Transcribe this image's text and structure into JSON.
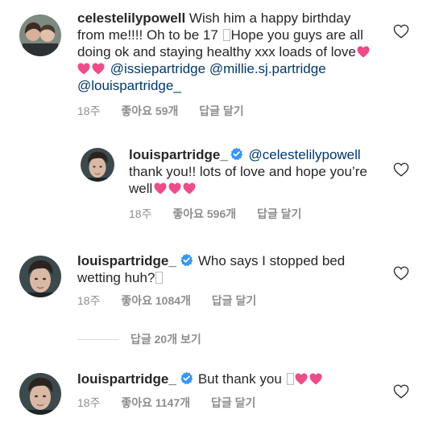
{
  "comments": [
    {
      "username": "celestelilypowell",
      "text_before": "Wish him a happy birthday from me!!!! Oh to be 17 ",
      "text_after": "Hope you guys are all doing ok and staying healthy xxx loads of love",
      "mentions": [
        "@issiepartridge",
        "@millie.sj.partridge",
        "@louispartridge_"
      ],
      "time": "18주",
      "likes": "좋아요 59개",
      "reply": "답글 달기"
    },
    {
      "username": "louispartridge_",
      "mention": "@celestelilypowell",
      "text": "thank you!! lots of love and hope you’re well",
      "time": "18주",
      "likes": "좋아요 596개",
      "reply": "답글 달기"
    },
    {
      "username": "louispartridge_",
      "text": "Who says I stopped bed wetting huh?",
      "time": "18주",
      "likes": "좋아요 1084개",
      "reply": "답글 달기"
    },
    {
      "username": "louispartridge_",
      "text": "But thank you ",
      "time": "18주",
      "likes": "좋아요 1147개",
      "reply": "답글 달기"
    }
  ],
  "view_replies": "답글 20개 보기",
  "colors": {
    "heart": "#ed4c8a",
    "verified": "#3897f0",
    "mention": "#00376b",
    "meta": "#8e8e8e"
  },
  "icons": [
    "heart-outline-icon",
    "verified-badge-icon",
    "heart-emoji-icon"
  ]
}
